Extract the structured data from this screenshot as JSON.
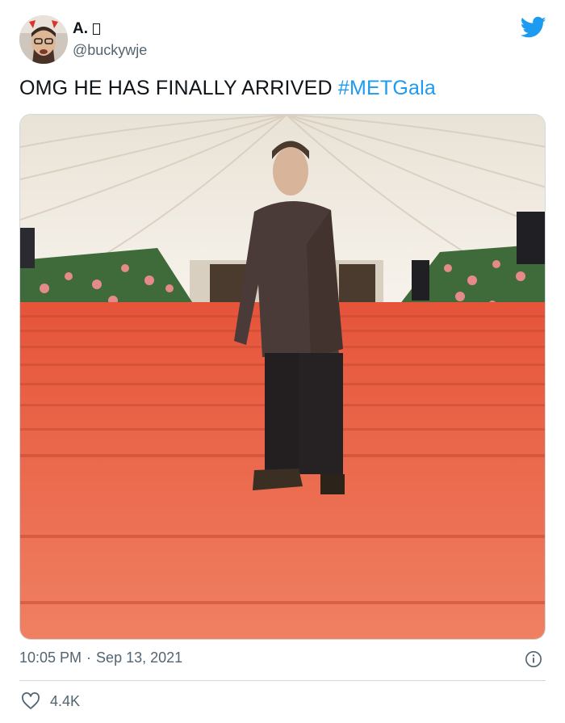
{
  "author": {
    "display_name": "A.",
    "name_emoji_glyph": "box",
    "handle": "@buckywje",
    "avatar_icon": "avatar-photo"
  },
  "brand": {
    "icon": "twitter-bird-icon",
    "color": "#1d9bf0"
  },
  "tweet": {
    "text": "OMG HE HAS FINALLY ARRIVED ",
    "hashtag": "#METGala",
    "image_alt_icon": "photo"
  },
  "meta": {
    "time": "10:05 PM",
    "separator": "·",
    "date": "Sep 13, 2021"
  },
  "stats": {
    "likes": "4.4K",
    "like_icon": "heart-icon",
    "info_icon": "info-icon"
  },
  "colors": {
    "text_primary": "#0f1419",
    "text_secondary": "#536471",
    "link": "#1d9bf0",
    "divider": "#cfd9de"
  }
}
